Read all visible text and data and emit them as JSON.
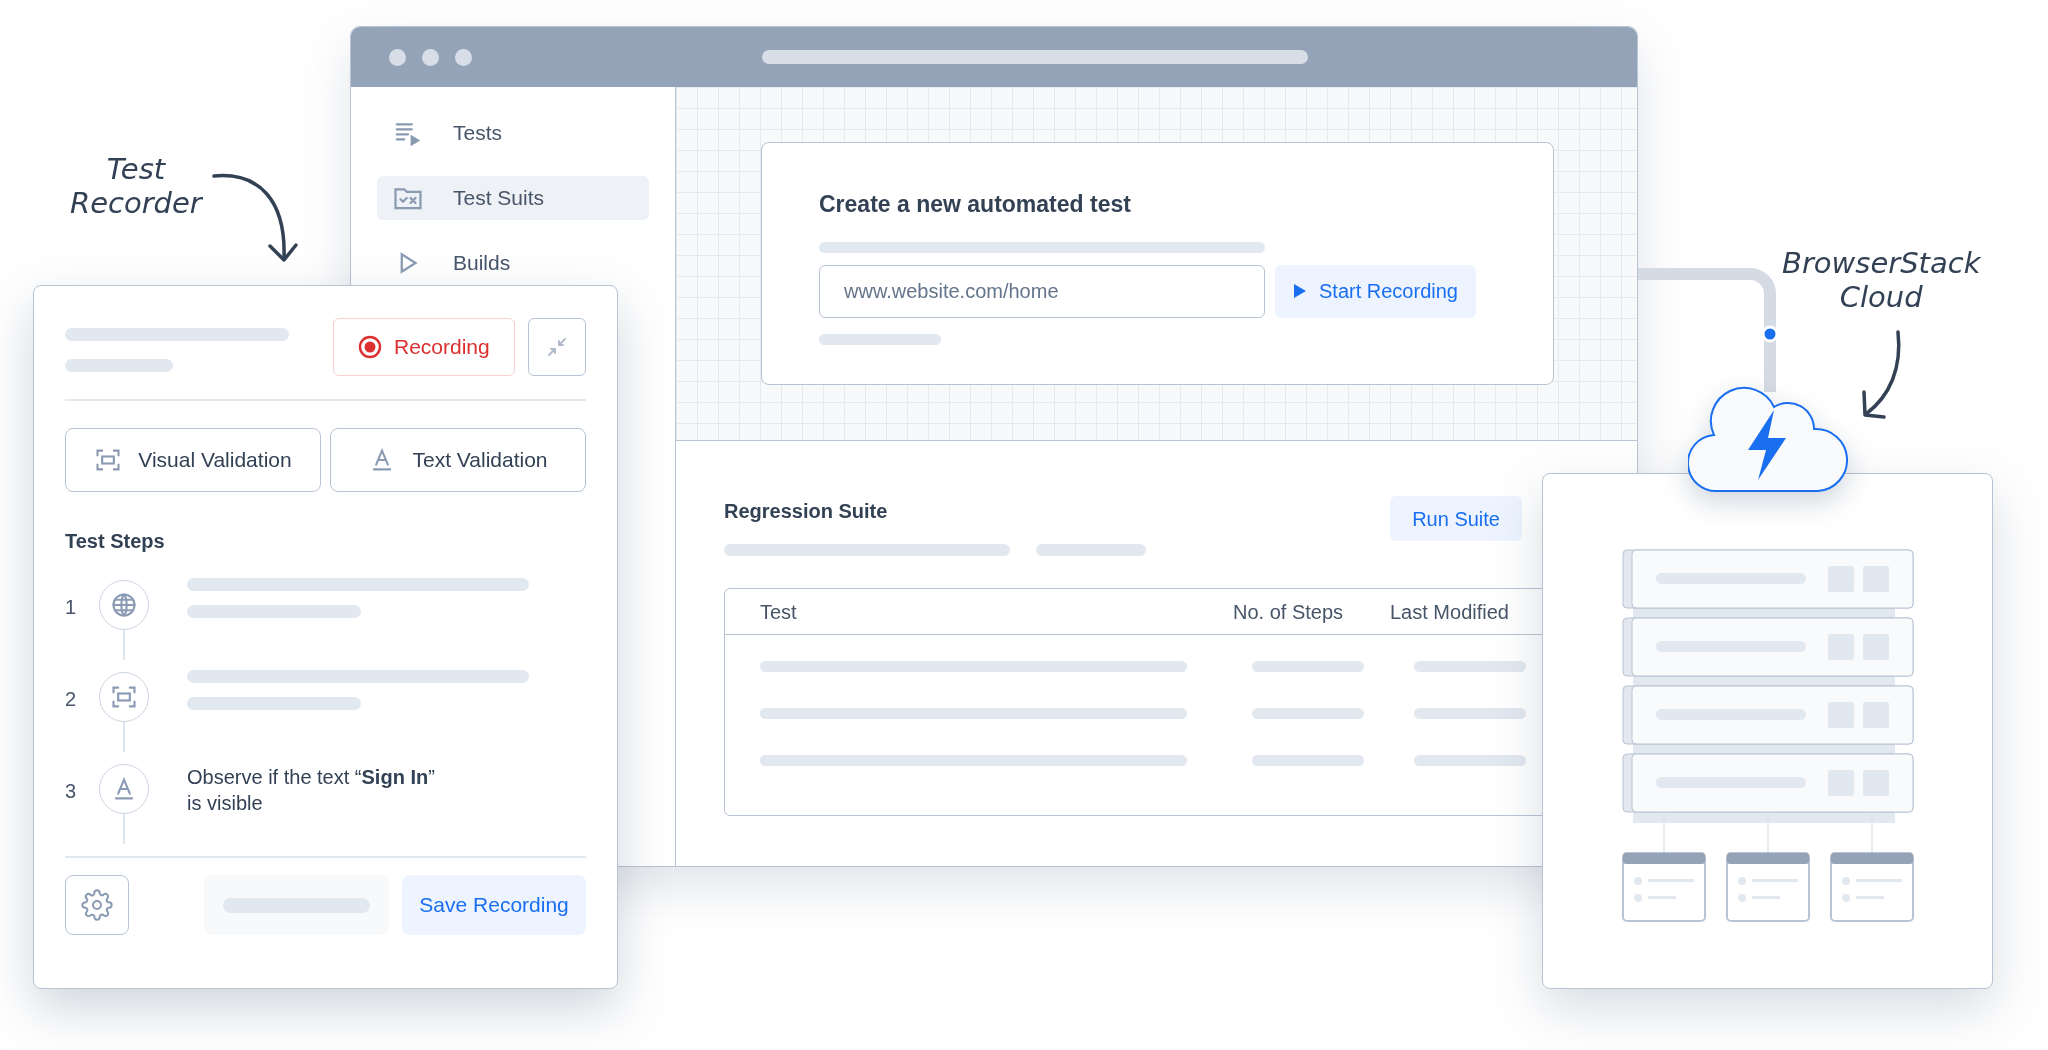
{
  "annotations": [
    {
      "lines": [
        "Test",
        "Recorder"
      ]
    },
    {
      "lines": [
        "BrowserStack",
        "Cloud"
      ]
    }
  ],
  "browser": {
    "sidebar": {
      "items": [
        {
          "label": "Tests",
          "selected": false
        },
        {
          "label": "Test Suits",
          "selected": true
        },
        {
          "label": "Builds",
          "selected": false
        }
      ]
    },
    "create_card": {
      "title": "Create a new automated test",
      "url_field": {
        "value": "www.website.com/home"
      },
      "start_button": "Start Recording"
    },
    "suite": {
      "title": "Regression Suite",
      "run_button": "Run Suite",
      "table": {
        "columns": [
          "Test",
          "No. of Steps",
          "Last Modified"
        ]
      }
    }
  },
  "recorder": {
    "recording_button": "Recording",
    "validation_buttons": [
      "Visual Validation",
      "Text Validation"
    ],
    "steps_title": "Test Steps",
    "steps": [
      {
        "number": "1",
        "kind": "skeleton"
      },
      {
        "number": "2",
        "kind": "skeleton"
      },
      {
        "number": "3",
        "kind": "text",
        "text": "Observe if the text “**Sign In**” is visible"
      }
    ],
    "save_button": "Save Recording"
  }
}
